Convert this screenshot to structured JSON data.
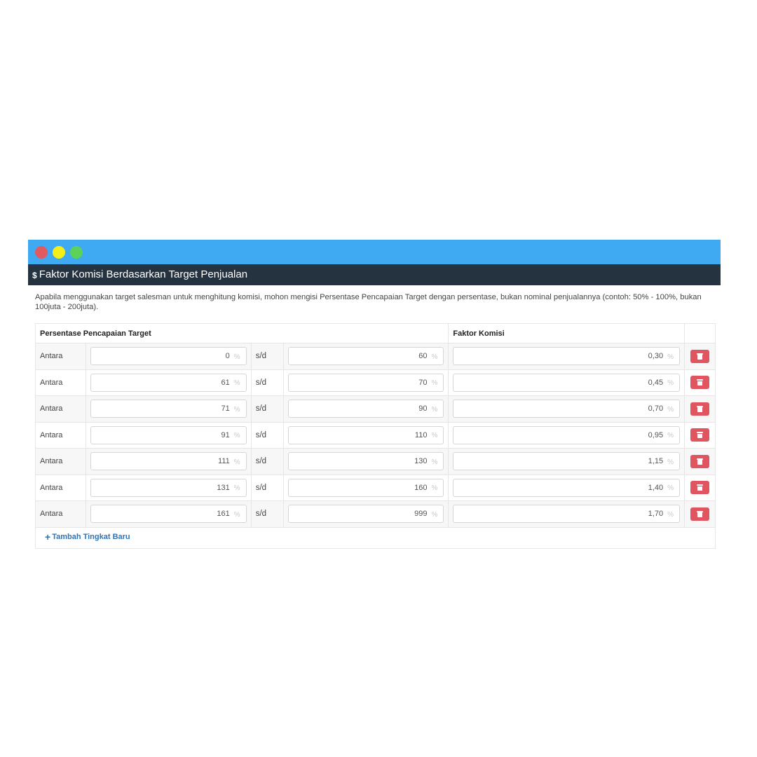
{
  "window": {
    "controls": [
      "close",
      "minimize",
      "maximize"
    ]
  },
  "panel": {
    "icon": "dollar-icon",
    "title": "Faktor Komisi Berdasarkan Target Penjualan",
    "note": "Apabila menggunakan target salesman untuk menghitung komisi, mohon mengisi Persentase Pencapaian Target dengan persentase, bukan nominal penjualannya (contoh: 50% - 100%, bukan 100juta - 200juta)."
  },
  "table": {
    "headers": {
      "target": "Persentase Pencapaian Target",
      "factor": "Faktor Komisi"
    },
    "row_label": "Antara",
    "separator": "s/d",
    "unit": "%",
    "rows": [
      {
        "from": "0",
        "to": "60",
        "factor": "0,30"
      },
      {
        "from": "61",
        "to": "70",
        "factor": "0,45"
      },
      {
        "from": "71",
        "to": "90",
        "factor": "0,70"
      },
      {
        "from": "91",
        "to": "110",
        "factor": "0,95"
      },
      {
        "from": "111",
        "to": "130",
        "factor": "1,15"
      },
      {
        "from": "131",
        "to": "160",
        "factor": "1,40"
      },
      {
        "from": "161",
        "to": "999",
        "factor": "1,70"
      }
    ],
    "add_label": "Tambah Tingkat Baru"
  },
  "colors": {
    "titlebar": "#3fa9f1",
    "header_bar": "#253341",
    "delete_button": "#e05560",
    "link": "#2f74b5"
  }
}
